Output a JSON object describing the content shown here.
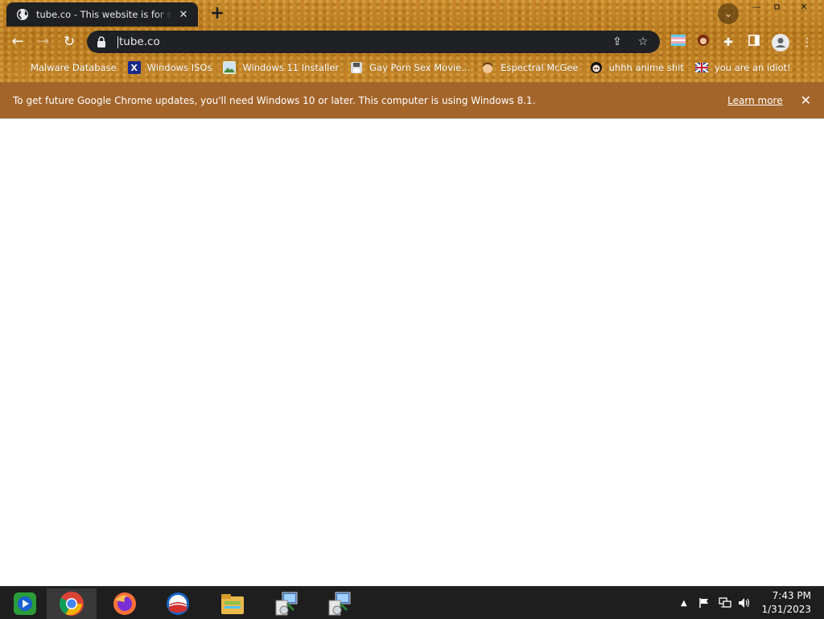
{
  "tab": {
    "title": "tube.co - This website is for sale!",
    "icon": "globe-icon"
  },
  "window": {
    "minimize": "—",
    "maximize": "⧉",
    "close": "✕"
  },
  "toolbar": {
    "back": "←",
    "forward": "→",
    "reload": "↻"
  },
  "omnibox": {
    "url": "tube.co"
  },
  "bookmarks": [
    {
      "label": "Malware Database",
      "icon": "none"
    },
    {
      "label": "Windows ISOs",
      "icon": "x-logo-icon"
    },
    {
      "label": "Windows 11 Installer",
      "icon": "image-icon"
    },
    {
      "label": "Gay Porn Sex Movie...",
      "icon": "floppy-icon"
    },
    {
      "label": "Espectral McGee",
      "icon": "face-icon"
    },
    {
      "label": "uhhh anime shit",
      "icon": "anime-face-icon"
    },
    {
      "label": "you are an idiot!",
      "icon": "flag-icon"
    }
  ],
  "infobar": {
    "message": "To get future Google Chrome updates, you'll need Windows 10 or later. This computer is using Windows 8.1.",
    "learn_more": "Learn more"
  },
  "taskbar": {
    "apps": [
      "windows-media-center-icon",
      "chrome-icon",
      "firefox-icon",
      "outlook-icon",
      "file-explorer-icon",
      "installer-icon",
      "installer-icon"
    ],
    "active": "chrome-icon"
  },
  "clock": {
    "time": "7:43 PM",
    "date": "1/31/2023"
  },
  "colors": {
    "infobar": "#a4652a",
    "omnibox": "#202124",
    "taskbar": "#1e1e1e"
  }
}
